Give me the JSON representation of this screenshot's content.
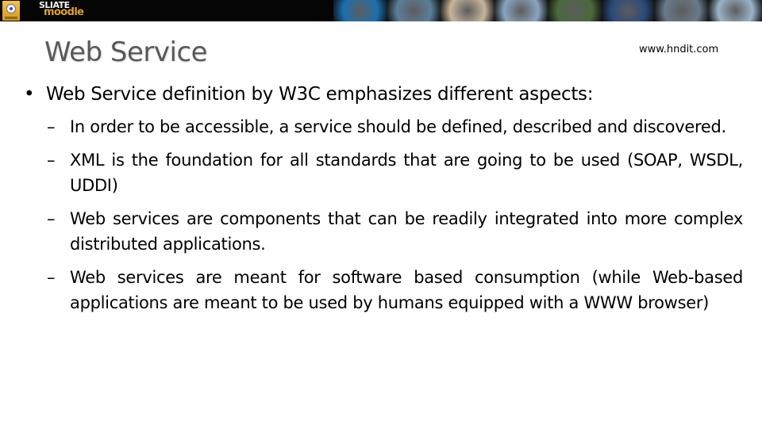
{
  "banner": {
    "logo_top": "SLIATE",
    "logo_bottom": "moodle",
    "photos": [
      {
        "icon": "globe-eye-photo",
        "color": "#1a6fb0"
      },
      {
        "icon": "touchscreen-photo",
        "color": "#5a7f9a"
      },
      {
        "icon": "people-laptop-photo",
        "color": "#c8b49a"
      },
      {
        "icon": "keyboard-photo",
        "color": "#8aa4c0"
      },
      {
        "icon": "classroom-photo",
        "color": "#4a6a3a"
      },
      {
        "icon": "globe-hand-photo",
        "color": "#2a4a7a"
      },
      {
        "icon": "robot-face-photo",
        "color": "#6a7a8a"
      },
      {
        "icon": "eye-closeup-photo",
        "color": "#9ab4c8"
      }
    ]
  },
  "slide": {
    "title": "Web Service",
    "site": "www.hndit.com",
    "bullet_symbol": "•",
    "dash_symbol": "–",
    "main_point": "Web Service definition by W3C emphasizes different aspects:",
    "sub_points": [
      "In order to be accessible, a service should be defined, described and discovered.",
      "XML is the foundation for all standards that are going to be used (SOAP, WSDL, UDDI)",
      "Web services are components that can be readily integrated into more complex distributed applications.",
      "Web services are meant for software based consumption (while Web-based applications are meant to be used by humans equipped with a WWW browser)"
    ]
  },
  "colors": {
    "title": "#595959",
    "banner_bg": "#050505",
    "brand_accent": "#e0a12a"
  }
}
